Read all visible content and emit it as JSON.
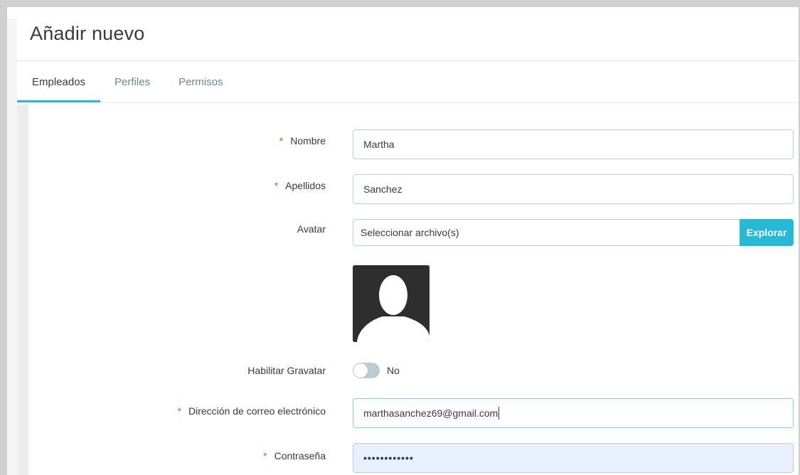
{
  "page": {
    "title": "Añadir nuevo"
  },
  "tabs": [
    {
      "label": "Empleados",
      "active": true
    },
    {
      "label": "Perfiles",
      "active": false
    },
    {
      "label": "Permisos",
      "active": false
    }
  ],
  "form": {
    "required_mark": "*",
    "nombre": {
      "label": "Nombre",
      "value": "Martha"
    },
    "apellidos": {
      "label": "Apellidos",
      "value": "Sanchez"
    },
    "avatar": {
      "label": "Avatar",
      "file_placeholder": "Seleccionar archivo(s)",
      "browse_label": "Explorar"
    },
    "gravatar": {
      "label": "Habilitar Gravatar",
      "state": "No"
    },
    "email": {
      "label": "Dirección de correo electrónico",
      "value": "marthasanchez69@gmail.com"
    },
    "password": {
      "label": "Contraseña",
      "value": "••••••••••••"
    }
  },
  "colors": {
    "accent": "#25b9d7",
    "required": "#d9534f",
    "text": "#363a41",
    "muted": "#6c868e",
    "autofill": "#e8f0fe"
  }
}
